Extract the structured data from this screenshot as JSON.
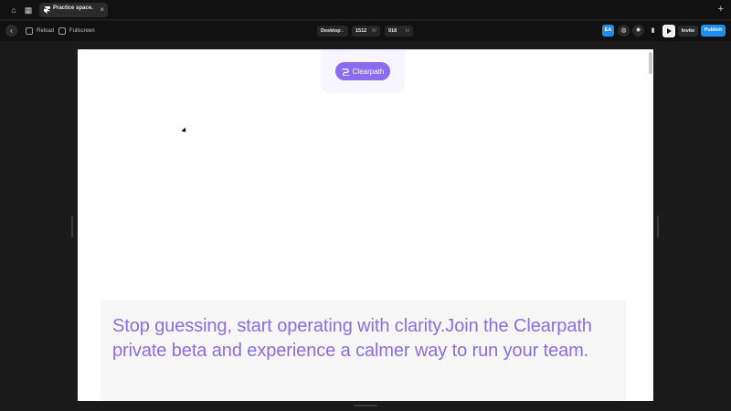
{
  "titlebar": {
    "tab_title": "Practice space.",
    "tab_close": "×",
    "new_tab": "+"
  },
  "toolbar": {
    "reload_label": "Reload",
    "fullscreen_label": "Fullscreen",
    "device_value": "Desktop",
    "width_value": "1512",
    "width_suffix": "W",
    "height_value": "918",
    "height_suffix": "H",
    "avatar_initials": "EA",
    "invite_label": "Invite",
    "publish_label": "Publish"
  },
  "page": {
    "brand_label": "Clearpath",
    "hero_text": "Stop guessing, start operating with clarity.Join the Clearpath private beta and experience a calmer way to run your team."
  },
  "colors": {
    "accent": "#8b6cf0",
    "publish": "#1f8ef1",
    "hero_text": "#8a6ee6"
  }
}
